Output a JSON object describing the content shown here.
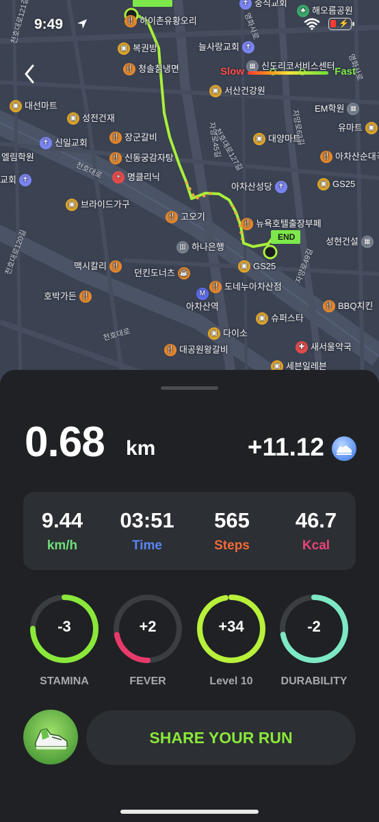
{
  "status_bar": {
    "time": "9:49"
  },
  "map": {
    "speed_legend": {
      "slow": "Slow",
      "fast": "Fast"
    },
    "end_flag": "END",
    "pois": [
      {
        "label": "중식교회",
        "icon": "church-icon",
        "kind": "blue"
      },
      {
        "label": "해오름공원",
        "icon": "park-icon",
        "kind": "green"
      },
      {
        "label": "하이촌유황오리",
        "icon": "restaurant-icon",
        "kind": "food"
      },
      {
        "label": "복권방",
        "icon": "shop-icon",
        "kind": "shop"
      },
      {
        "label": "늘사랑교회",
        "icon": "church-icon",
        "kind": "blue"
      },
      {
        "label": "신도리코서비스센터",
        "icon": "office-icon",
        "kind": "gray"
      },
      {
        "label": "청솔칡냉면",
        "icon": "restaurant-icon",
        "kind": "food"
      },
      {
        "label": "서산건강원",
        "icon": "shop-icon",
        "kind": "shop"
      },
      {
        "label": "대선마트",
        "icon": "shop-icon",
        "kind": "shop"
      },
      {
        "label": "성전건재",
        "icon": "shop-icon",
        "kind": "shop"
      },
      {
        "label": "EM학원",
        "icon": "school-icon",
        "kind": "gray"
      },
      {
        "label": "유마트",
        "icon": "shop-icon",
        "kind": "shop"
      },
      {
        "label": "신일교회",
        "icon": "church-icon",
        "kind": "blue"
      },
      {
        "label": "장군갈비",
        "icon": "restaurant-icon",
        "kind": "food"
      },
      {
        "label": "대양마트",
        "icon": "shop-icon",
        "kind": "shop"
      },
      {
        "label": "엘림학원",
        "icon": "school-icon",
        "kind": "gray"
      },
      {
        "label": "신동궁감자탕",
        "icon": "restaurant-icon",
        "kind": "food"
      },
      {
        "label": "아차산순대국",
        "icon": "restaurant-icon",
        "kind": "food"
      },
      {
        "label": "명클리닉",
        "icon": "hospital-icon",
        "kind": "red"
      },
      {
        "label": "교회",
        "icon": "church-icon",
        "kind": "blue"
      },
      {
        "label": "아차산성당",
        "icon": "church-icon",
        "kind": "blue"
      },
      {
        "label": "GS25",
        "icon": "store-icon",
        "kind": "shop"
      },
      {
        "label": "브라이드가구",
        "icon": "furniture-icon",
        "kind": "shop"
      },
      {
        "label": "고오기",
        "icon": "restaurant-icon",
        "kind": "food"
      },
      {
        "label": "뉴욕호텔출장부페",
        "icon": "restaurant-icon",
        "kind": "food"
      },
      {
        "label": "하나은행",
        "icon": "bank-icon",
        "kind": "gray"
      },
      {
        "label": "성현건설",
        "icon": "office-icon",
        "kind": "gray"
      },
      {
        "label": "GS25",
        "icon": "store-icon",
        "kind": "shop"
      },
      {
        "label": "맥시칼리",
        "icon": "restaurant-icon",
        "kind": "food"
      },
      {
        "label": "던킨도너츠",
        "icon": "cafe-icon",
        "kind": "food"
      },
      {
        "label": "도네누아차산점",
        "icon": "restaurant-icon",
        "kind": "food"
      },
      {
        "label": "호박가든",
        "icon": "restaurant-icon",
        "kind": "food"
      },
      {
        "label": "아차산역",
        "icon": "subway-icon",
        "kind": "purple"
      },
      {
        "label": "BBQ치킨",
        "icon": "restaurant-icon",
        "kind": "food"
      },
      {
        "label": "슈퍼스타",
        "icon": "shop-icon",
        "kind": "shop"
      },
      {
        "label": "다이소",
        "icon": "shop-icon",
        "kind": "shop"
      },
      {
        "label": "새서울약국",
        "icon": "pharmacy-icon",
        "kind": "red"
      },
      {
        "label": "대공원왕갈비",
        "icon": "restaurant-icon",
        "kind": "food"
      },
      {
        "label": "세븐일레븐",
        "icon": "store-icon",
        "kind": "shop"
      }
    ],
    "street_labels": [
      "천호대로",
      "천호대로",
      "자양로45길",
      "천호대로127길",
      "자양로63길",
      "자양로49길",
      "영화사로",
      "천호대로120길",
      "천호대로121길",
      "영화사로"
    ]
  },
  "summary": {
    "distance_value": "0.68",
    "distance_unit": "km",
    "earnings": "+11.12"
  },
  "stats": [
    {
      "value": "9.44",
      "label": "km/h",
      "color": "#6fe07a"
    },
    {
      "value": "03:51",
      "label": "Time",
      "color": "#5b86f5"
    },
    {
      "value": "565",
      "label": "Steps",
      "color": "#f06a3a"
    },
    {
      "value": "46.7",
      "label": "Kcal",
      "color": "#e8447a"
    }
  ],
  "rings": [
    {
      "value": "-3",
      "label": "STAMINA",
      "fill": 0.75,
      "color": "#8ae83a",
      "start": "top"
    },
    {
      "value": "+2",
      "label": "FEVER",
      "fill": 0.22,
      "color": "#e83a6a",
      "start": "bottom"
    },
    {
      "value": "+34",
      "label": "Level 10",
      "fill": 0.97,
      "color": "#b8f03a",
      "start": "top"
    },
    {
      "value": "-2",
      "label": "DURABILITY",
      "fill": 0.72,
      "color": "#7de8c4",
      "start": "top"
    }
  ],
  "share_button": "SHARE YOUR RUN"
}
